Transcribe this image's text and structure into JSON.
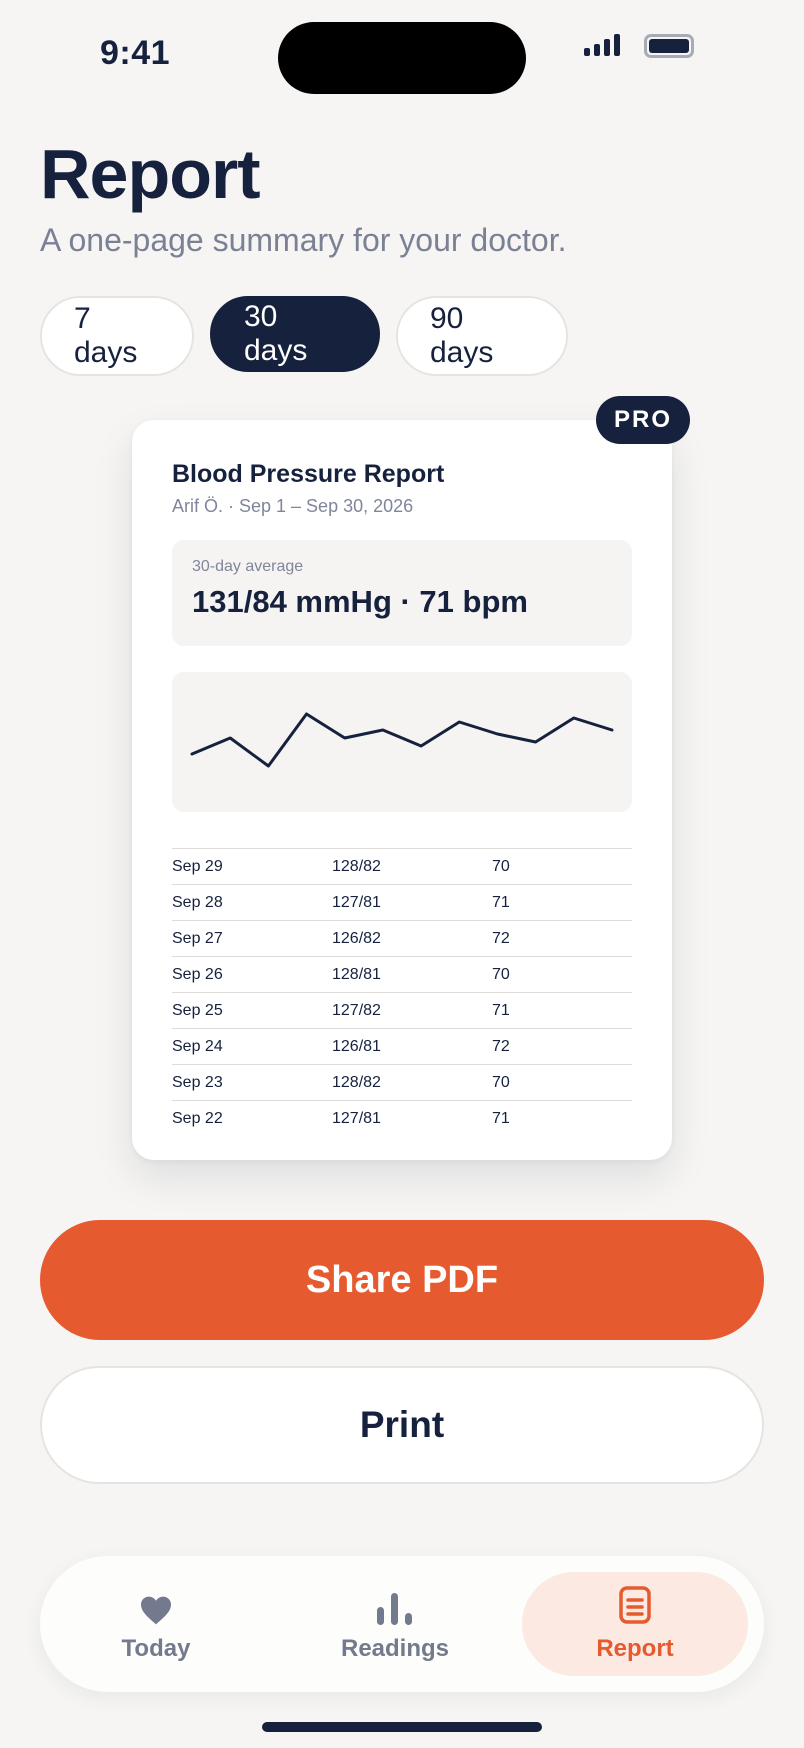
{
  "status_bar": {
    "time": "9:41"
  },
  "header": {
    "title": "Report",
    "subtitle": "A one-page summary for your doctor."
  },
  "range_chips": [
    {
      "label": "7 days",
      "selected": false
    },
    {
      "label": "30 days",
      "selected": true
    },
    {
      "label": "90 days",
      "selected": false
    }
  ],
  "report": {
    "badge": "PRO",
    "title": "Blood Pressure Report",
    "meta": "Arif Ö. · Sep 1 – Sep 30, 2026",
    "average_label": "30-day average",
    "average_value": "131/84 mmHg · 71 bpm",
    "readings": [
      {
        "date": "Sep 29",
        "bp": "128/82",
        "pulse": "70"
      },
      {
        "date": "Sep 28",
        "bp": "127/81",
        "pulse": "71"
      },
      {
        "date": "Sep 27",
        "bp": "126/82",
        "pulse": "72"
      },
      {
        "date": "Sep 26",
        "bp": "128/81",
        "pulse": "70"
      },
      {
        "date": "Sep 25",
        "bp": "127/82",
        "pulse": "71"
      },
      {
        "date": "Sep 24",
        "bp": "126/81",
        "pulse": "72"
      },
      {
        "date": "Sep 23",
        "bp": "128/82",
        "pulse": "70"
      },
      {
        "date": "Sep 22",
        "bp": "127/81",
        "pulse": "71"
      }
    ]
  },
  "chart_data": {
    "type": "line",
    "title": "",
    "xlabel": "",
    "ylabel": "",
    "x": [
      1,
      2,
      3,
      4,
      5,
      6,
      7,
      8,
      9,
      10,
      11,
      12
    ],
    "series": [
      {
        "values": [
          0.35,
          0.55,
          0.2,
          0.85,
          0.55,
          0.65,
          0.45,
          0.75,
          0.6,
          0.5,
          0.8,
          0.65
        ]
      }
    ],
    "grid": false,
    "color": "#16213d"
  },
  "actions": {
    "share_label": "Share PDF",
    "print_label": "Print"
  },
  "tab_bar": {
    "items": [
      {
        "label": "Today",
        "icon": "heart-icon",
        "active": false
      },
      {
        "label": "Readings",
        "icon": "bar-chart-icon",
        "active": false
      },
      {
        "label": "Report",
        "icon": "document-icon",
        "active": true
      }
    ]
  },
  "colors": {
    "accent": "#e55a2f",
    "navy": "#16213d",
    "background": "#f6f5f3",
    "muted": "#737a8d"
  }
}
